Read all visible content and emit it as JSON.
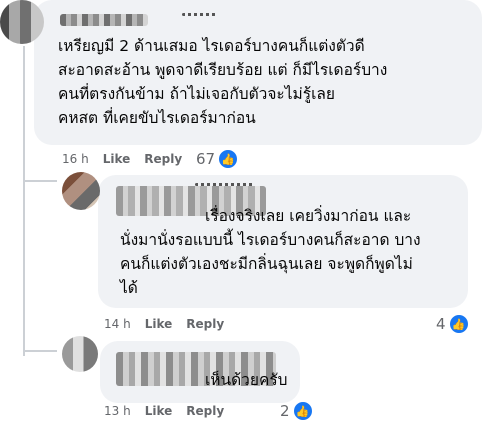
{
  "comments": [
    {
      "text_lines": [
        "เหรียญมี 2 ด้านเสมอ ไรเดอร์บางคนก็แต่งตัวดี",
        "สะอาดสะอ้าน พูดจาดีเรียบร้อย แต่ ก็มีไรเดอร์บาง",
        "คนที่ตรงกันข้าม ถ้าไม่เจอกับตัวจะไม่รู้เลย",
        "คหสต ที่เคยขับไรเดอร์มาก่อน"
      ],
      "time": "16 h",
      "like_label": "Like",
      "reply_label": "Reply",
      "reaction_count": "67"
    },
    {
      "first_line": "เรื่องจริงเลย เคยวิ่งมาก่อน และ",
      "text_lines": [
        "นั่งมานั่งรอแบบนี้ ไรเดอร์บางคนก็สะอาด บาง",
        "คนก็แต่งตัวเองชะมีกลิ่นฉุนเลย จะพูดก็พูดไม่",
        "ได้"
      ],
      "time": "14 h",
      "like_label": "Like",
      "reply_label": "Reply",
      "reaction_count": "4"
    },
    {
      "text": "เห็นด้วยครับ",
      "time": "13 h",
      "like_label": "Like",
      "reply_label": "Reply",
      "reaction_count": "2"
    }
  ],
  "icons": {
    "reaction": "like-thumb-icon"
  },
  "colors": {
    "bubble": "#f0f2f5",
    "like_blue": "#1877f2",
    "meta_gray": "#65676b"
  }
}
